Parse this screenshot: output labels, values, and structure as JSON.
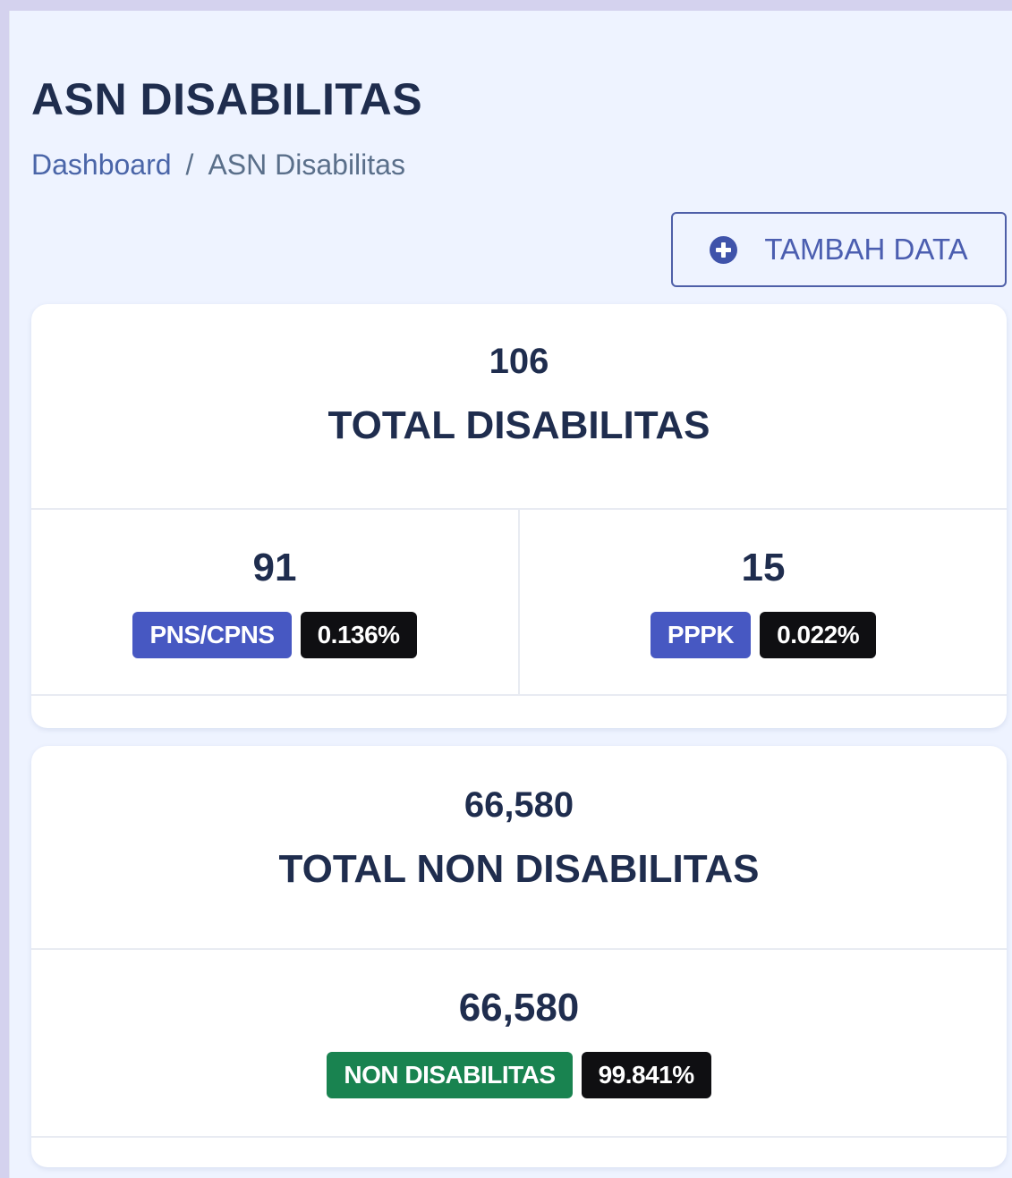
{
  "header": {
    "title": "ASN DISABILITAS",
    "breadcrumb": {
      "home": "Dashboard",
      "separator": "/",
      "current": "ASN Disabilitas"
    }
  },
  "actions": {
    "add_icon": "plus-circle-icon",
    "add_label": "TAMBAH DATA"
  },
  "disabilitas_card": {
    "total": "106",
    "label": "TOTAL DISABILITAS",
    "pns": {
      "count": "91",
      "label": "PNS/CPNS",
      "percent": "0.136%"
    },
    "pppk": {
      "count": "15",
      "label": "PPPK",
      "percent": "0.022%"
    }
  },
  "non_disabilitas_card": {
    "total": "66,580",
    "label": "TOTAL NON DISABILITAS",
    "non": {
      "count": "66,580",
      "label": "NON DISABILITAS",
      "percent": "99.841%"
    }
  },
  "colors": {
    "primary": "#4758c2",
    "success": "#198350",
    "dark": "#0f0f12",
    "heading": "#1f2d4e",
    "page_bg": "#eef3ff"
  }
}
